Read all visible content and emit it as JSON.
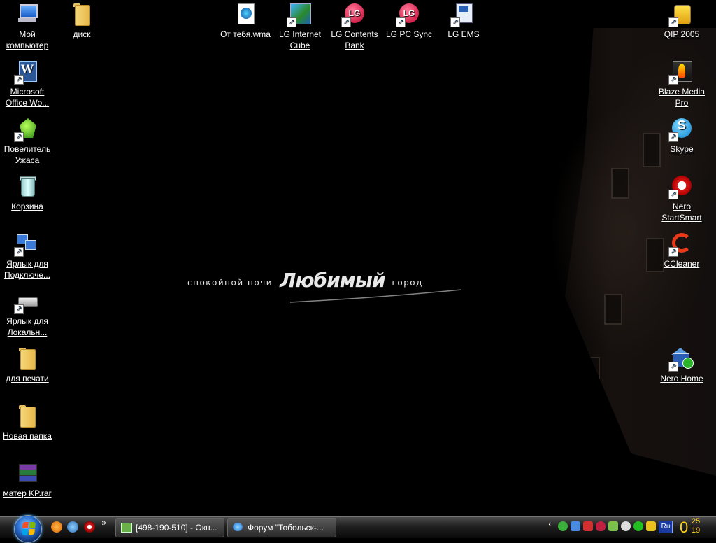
{
  "wallpaper": {
    "text_left": "спокойной  ночи",
    "text_big": "Любимый",
    "text_right": "город"
  },
  "desktop_icons": {
    "my_computer": "Мой компьютер",
    "disk": "диск",
    "ms_office_word": "Microsoft Office Wo...",
    "povelitel": "Повелитель Ужаса",
    "recycle_bin": "Корзина",
    "shortcut_connect": "Ярлык для Подключе...",
    "shortcut_local": "Ярлык для Локальн...",
    "for_print": "для печати",
    "new_folder": "Новая папка",
    "mater_rar": "матер KP.rar",
    "ot_tebya": "От тебя.wma",
    "lg_internet_cube": "LG Internet Cube",
    "lg_contents_bank": "LG Contents Bank",
    "lg_pc_sync": "LG PC Sync",
    "lg_ems": "LG EMS",
    "qip": "QIP 2005",
    "blaze": "Blaze Media Pro",
    "skype": "Skype",
    "nero_startsmart": "Nero StartSmart",
    "ccleaner": "CCleaner",
    "nero_home": "Nero Home"
  },
  "taskbar": {
    "quicklaunch_more": "»",
    "task1": "[498-190-510] - Окн...",
    "task2": "Форум \"Тобольск-...",
    "tray_expand": "‹",
    "lang": "Ru",
    "clock_hour": "0",
    "clock_min_top": "25",
    "clock_min_bottom": "19"
  },
  "colors": {
    "clock": "#ffd21a",
    "taskbar_top": "#4a4a4a",
    "taskbar_bottom": "#0a0a0a",
    "desktop_bg": "#000000"
  },
  "icons": [
    "computer-icon",
    "folder-icon",
    "word-icon",
    "game-icon",
    "recycle-bin-icon",
    "network-icon",
    "drive-icon",
    "winrar-icon",
    "media-file-icon",
    "lg-icon",
    "phone-icon",
    "qip-icon",
    "blaze-icon",
    "skype-icon",
    "nero-icon",
    "ccleaner-icon",
    "nero-home-icon",
    "windows-logo-icon",
    "ie-icon"
  ]
}
